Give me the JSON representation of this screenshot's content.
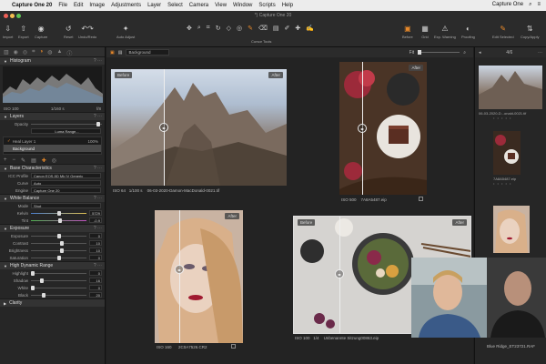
{
  "menubar": {
    "app": "Capture One 20",
    "items": [
      "File",
      "Edit",
      "Image",
      "Adjustments",
      "Layer",
      "Select",
      "Camera",
      "View",
      "Window",
      "Scripts",
      "Help"
    ],
    "right_label": "Capture One"
  },
  "window": {
    "title": "*) Capture One 20"
  },
  "toolbar": {
    "left": [
      {
        "label": "Import",
        "icon": "import-icon"
      },
      {
        "label": "Export",
        "icon": "export-icon"
      },
      {
        "label": "Capture",
        "icon": "camera-icon"
      },
      {
        "label": "Reset",
        "icon": "reset-icon"
      },
      {
        "label": "Undo/Redo",
        "icon": "undo-icon"
      },
      {
        "label": "Auto Adjust",
        "icon": "auto-adjust-icon"
      }
    ],
    "cursor_label": "Cursor Tools",
    "right": [
      {
        "label": "Before",
        "icon": "before-icon"
      },
      {
        "label": "Grid",
        "icon": "grid-icon"
      },
      {
        "label": "Exp. Warning",
        "icon": "warning-icon"
      },
      {
        "label": "Proofing",
        "icon": "proofing-icon"
      },
      {
        "label": "Edit Selected",
        "icon": "edit-selected-icon"
      },
      {
        "label": "Copy/Apply",
        "icon": "copy-apply-icon"
      }
    ]
  },
  "histogram": {
    "title": "Histogram",
    "iso": "ISO 100",
    "shutter": "1/160 s",
    "aperture": "f/8"
  },
  "layers": {
    "title": "Layers",
    "opacity_label": "Opacity",
    "curve_btn": "Luma Range...",
    "items": [
      {
        "name": "Heal Layer 1",
        "value": "100%"
      },
      {
        "name": "Background",
        "value": ""
      }
    ]
  },
  "base_characteristics": {
    "title": "Base Characteristics",
    "icc_label": "ICC Profile",
    "icc_value": "Canon EOS-5D Mk IV Generic",
    "curve_label": "Curve",
    "curve_value": "Auto",
    "engine_label": "Engine",
    "engine_value": "Capture One 20"
  },
  "white_balance": {
    "title": "White Balance",
    "mode_label": "Mode",
    "mode_value": "Shot",
    "kelvin_label": "Kelvin",
    "kelvin_value": "5729",
    "tint_label": "Tint",
    "tint_value": "-0.9"
  },
  "exposure": {
    "title": "Exposure",
    "rows": [
      {
        "label": "Exposure",
        "value": "0"
      },
      {
        "label": "Contrast",
        "value": "10"
      },
      {
        "label": "Brightness",
        "value": "10"
      },
      {
        "label": "Saturation",
        "value": "0"
      }
    ]
  },
  "hdr": {
    "title": "High Dynamic Range",
    "rows": [
      {
        "label": "Highlight",
        "value": "0"
      },
      {
        "label": "Shadow",
        "value": "16"
      },
      {
        "label": "White",
        "value": "0"
      },
      {
        "label": "Black",
        "value": "20"
      }
    ]
  },
  "clarity": {
    "title": "Clarity"
  },
  "viewerbar": {
    "layer": "Background",
    "fit": "Fit",
    "count": "4/6"
  },
  "viewer": {
    "before_label": "Before",
    "after_label": "After",
    "images": [
      {
        "iso": "ISO 64",
        "shutter": "1/100 s",
        "name": "06-03-2020-Damon-MacDonald-0021.tif"
      },
      {
        "iso": "ISO 500",
        "shutter": "",
        "name": "7A8A5487.eip"
      },
      {
        "iso": "ISO 160",
        "shutter": "",
        "name": "2C0A7526.CR2"
      },
      {
        "iso": "ISO 100",
        "shutter": "1/4",
        "name": "Unbenannte Sitzung00863.eip"
      }
    ]
  },
  "browser": {
    "thumbs": [
      {
        "name": "06-03-2020-D...onald-0021.tif"
      },
      {
        "name": "7A8A5487.eip"
      },
      {
        "name": ""
      }
    ]
  },
  "webcam": {
    "caption": "Blue Ridge_ET23721.RAF"
  }
}
